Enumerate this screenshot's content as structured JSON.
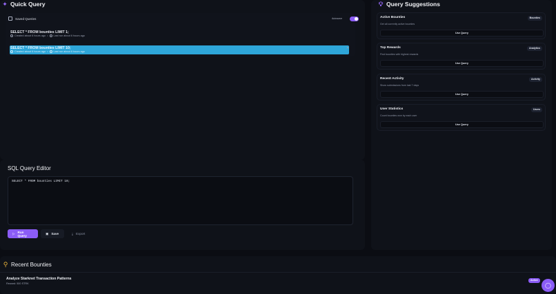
{
  "quick_query": {
    "title": "Quick Query",
    "saved_queries_label": "Saved Queries",
    "autosave_label": "Autosave",
    "queries": [
      {
        "text": "SELECT * FROM bounties LIMIT 1;",
        "created": "Created about 6 hours ago",
        "last_run": "Last run about 6 hours ago"
      },
      {
        "text": "SELECT * FROM bounties LIMIT 10;",
        "created": "Created about 6 hours ago",
        "last_run": "Last run about 6 hours ago"
      }
    ]
  },
  "sql_editor": {
    "title": "SQL Query Editor",
    "query": "SELECT * FROM bounties LIMIT 10;",
    "run_label": "Run Query",
    "save_label": "Save",
    "export_label": "Export"
  },
  "suggestions": {
    "title": "Query Suggestions",
    "use_label": "Use Query",
    "items": [
      {
        "title": "Active Bounties",
        "badge": "Bounties",
        "desc": "Get all currently active bounties"
      },
      {
        "title": "Top Rewards",
        "badge": "Analytics",
        "desc": "Find bounties with highest rewards"
      },
      {
        "title": "Recent Activity",
        "badge": "Activity",
        "desc": "Show submissions from last 7 days"
      },
      {
        "title": "User Statistics",
        "badge": "Users",
        "desc": "Count bounties won by each user"
      }
    ]
  },
  "recent_bounties": {
    "title": "Recent Bounties",
    "items": [
      {
        "title": "Analyze Starknet Transaction Patterns",
        "reward": "Reward: 500 STRK",
        "status": "Active"
      }
    ]
  },
  "colors": {
    "accent": "#8b5cf6",
    "selected_row": "#2ea6d9",
    "background": "#0b0d13"
  }
}
